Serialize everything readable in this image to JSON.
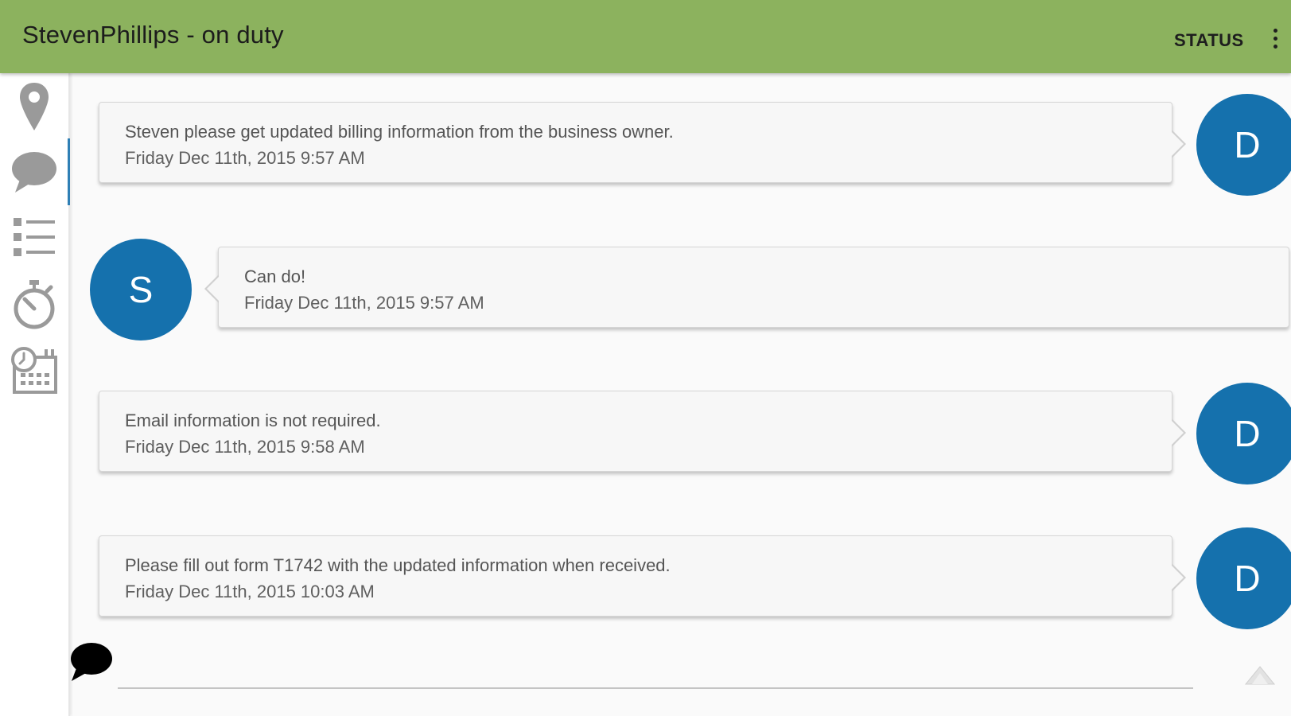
{
  "appbar": {
    "title": "StevenPhillips - on duty",
    "status_label": "STATUS",
    "menu_icon": "more-vert-icon",
    "color": "#8cb25e"
  },
  "sidebar": {
    "items": [
      {
        "name": "map",
        "icon": "map-pin-icon"
      },
      {
        "name": "messages",
        "icon": "chat-bubble-icon",
        "active": true
      },
      {
        "name": "tasks",
        "icon": "list-icon"
      },
      {
        "name": "timer",
        "icon": "stopwatch-icon"
      },
      {
        "name": "schedule",
        "icon": "calendar-clock-icon"
      }
    ]
  },
  "messages": [
    {
      "sender": "D",
      "direction": "incoming",
      "text": "Steven please get updated billing information from the business owner.",
      "timestamp": "Friday Dec 11th, 2015 9:57 AM"
    },
    {
      "sender": "S",
      "direction": "outgoing",
      "text": "Can do!",
      "timestamp": "Friday Dec 11th, 2015 9:57 AM"
    },
    {
      "sender": "D",
      "direction": "incoming",
      "text": "Email information is not required.",
      "timestamp": "Friday Dec 11th, 2015 9:58 AM"
    },
    {
      "sender": "D",
      "direction": "incoming",
      "text": "Please fill out form T1742 with the updated information when received.",
      "timestamp": "Friday Dec 11th, 2015 10:03 AM"
    }
  ],
  "composer": {
    "value": "",
    "placeholder": "",
    "icon": "chat-bubble-icon",
    "send_icon": "send-icon"
  },
  "colors": {
    "avatar": "#1571ad",
    "active_indicator": "#2f7fb5"
  }
}
